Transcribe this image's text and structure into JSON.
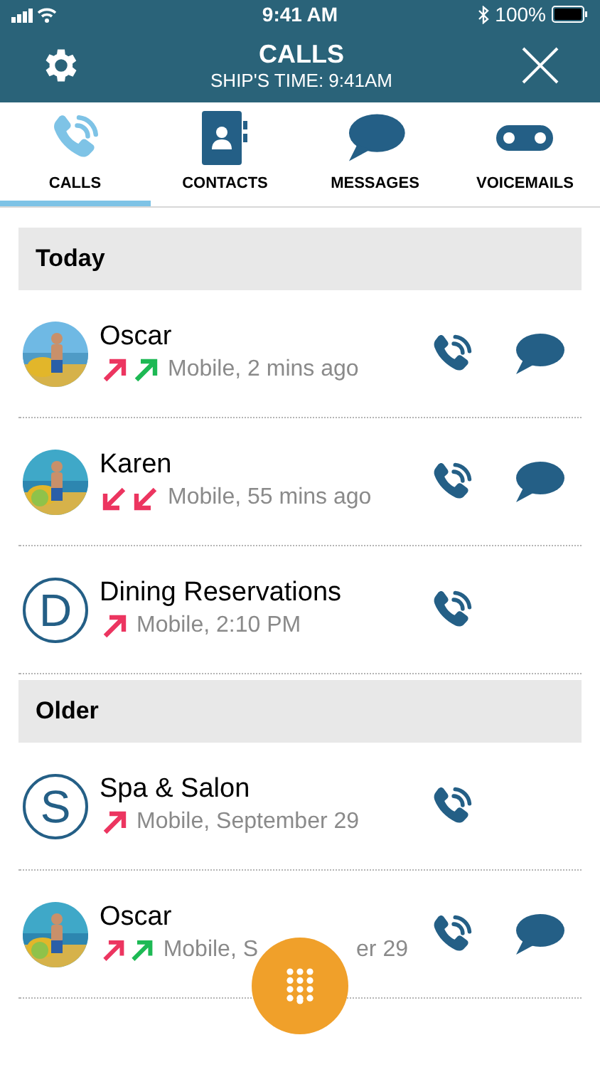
{
  "status_bar": {
    "time": "9:41 AM",
    "battery": "100%"
  },
  "header": {
    "title": "CALLS",
    "subtitle": "SHIP'S TIME: 9:41AM"
  },
  "tabs": [
    {
      "kind": "calls",
      "label": "CALLS",
      "selected": true
    },
    {
      "kind": "contacts",
      "label": "CONTACTS",
      "selected": false
    },
    {
      "kind": "messages",
      "label": "MESSAGES",
      "selected": false
    },
    {
      "kind": "voicemails",
      "label": "VOICEMAILS",
      "selected": false
    }
  ],
  "sections": [
    {
      "title": "Today",
      "calls": [
        {
          "name": "Oscar",
          "avatar": {
            "kind": "picture"
          },
          "arrows": [
            {
              "kind": "outgoing",
              "color": "#ec3560"
            },
            {
              "kind": "outgoing",
              "color": "#1db954"
            }
          ],
          "detail": "Mobile, 2 mins ago",
          "message": true
        },
        {
          "name": "Karen",
          "avatar": {
            "kind": "picture"
          },
          "arrows": [
            {
              "kind": "incoming",
              "color": "#ec3560"
            },
            {
              "kind": "incoming",
              "color": "#ec3560"
            }
          ],
          "detail": "Mobile, 55 mins ago",
          "message": true
        },
        {
          "name": "Dining Reservations",
          "avatar": {
            "kind": "letter",
            "letter": "D"
          },
          "arrows": [
            {
              "kind": "outgoing",
              "color": "#ec3560"
            }
          ],
          "detail": "Mobile, 2:10 PM",
          "message": false
        }
      ]
    },
    {
      "title": "Older",
      "calls": [
        {
          "name": "Spa & Salon",
          "avatar": {
            "kind": "letter",
            "letter": "S"
          },
          "arrows": [
            {
              "kind": "outgoing",
              "color": "#ec3560"
            }
          ],
          "detail": "Mobile, September 29",
          "message": false
        },
        {
          "name": "Oscar",
          "avatar": {
            "kind": "picture"
          },
          "arrows": [
            {
              "kind": "outgoing",
              "color": "#ec3560"
            },
            {
              "kind": "outgoing",
              "color": "#1db954"
            }
          ],
          "detail": "Mobile, S",
          "detail_end": "er 29",
          "message": true
        }
      ]
    }
  ]
}
